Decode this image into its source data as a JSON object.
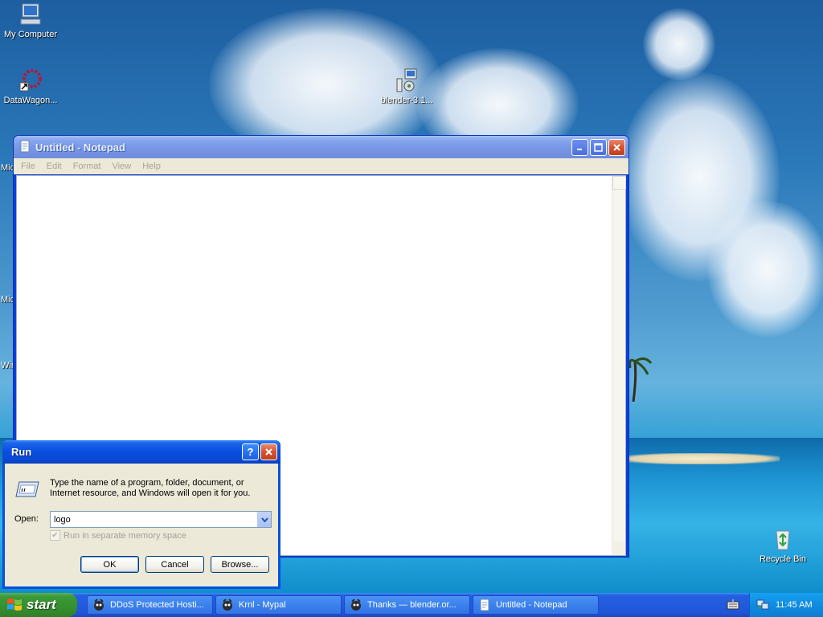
{
  "desktop": {
    "icons": [
      {
        "label": "My Computer",
        "icon": "my-computer-icon"
      },
      {
        "label": "DataWagon...",
        "icon": "datawagon-shortcut-icon"
      },
      {
        "label": "blender-3.1...",
        "icon": "blender-installer-icon"
      },
      {
        "label": "Recycle Bin",
        "icon": "recycle-bin-icon"
      }
    ],
    "clipped_labels": [
      "Mic",
      "Mic",
      "Wir"
    ]
  },
  "notepad": {
    "title": "Untitled - Notepad",
    "menu": [
      "File",
      "Edit",
      "Format",
      "View",
      "Help"
    ],
    "content": ""
  },
  "run_dialog": {
    "title": "Run",
    "help_label": "?",
    "description": "Type the name of a program, folder, document, or Internet resource, and Windows will open it for you.",
    "open_label": "Open:",
    "open_value": "logo",
    "checkbox_label": "Run in separate memory space",
    "checkbox_checked": true,
    "checkbox_enabled": false,
    "buttons": {
      "ok": "OK",
      "cancel": "Cancel",
      "browse": "Browse..."
    }
  },
  "taskbar": {
    "start_label": "start",
    "tasks": [
      {
        "label": "DDoS Protected Hosti...",
        "icon": "browser-icon"
      },
      {
        "label": "Krnl - Mypal",
        "icon": "browser-icon"
      },
      {
        "label": "Thanks — blender.or...",
        "icon": "browser-icon"
      },
      {
        "label": "Untitled - Notepad",
        "icon": "notepad-icon"
      }
    ],
    "clock": "11:45 AM"
  },
  "colors": {
    "xp_blue": "#0a4ee0",
    "start_green": "#36912f",
    "dialog_face": "#ece9d8"
  }
}
